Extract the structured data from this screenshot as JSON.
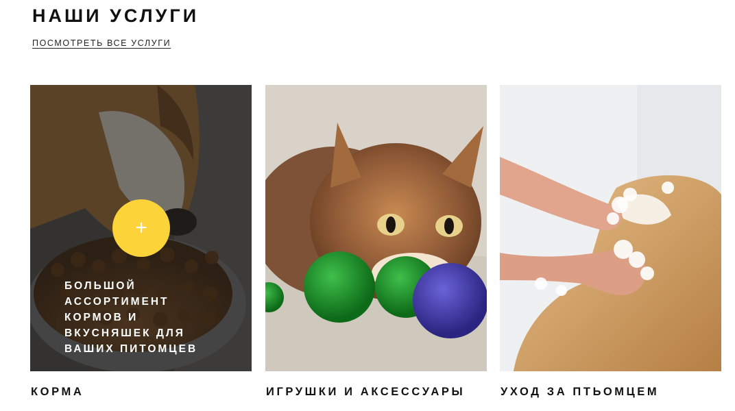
{
  "section": {
    "title": "НАШИ УСЛУГИ",
    "view_all": "ПОСМОТРЕТЬ ВСЕ УСЛУГИ"
  },
  "colors": {
    "accent": "#FDD33A",
    "overlay": "#1a1a1a"
  },
  "cards": [
    {
      "label": "КОРМА",
      "image": "dog-eating-kibble-photo",
      "hover": {
        "icon": "plus-icon",
        "symbol": "+",
        "text": "БОЛЬШОЙ АССОРТИМЕНТ КОРМОВ И ВКУСНЯШЕК ДЛЯ ВАШИХ ПИТОМЦЕВ"
      }
    },
    {
      "label": "ИГРУШКИ И АКСЕССУАРЫ",
      "image": "kitten-with-toy-balls-photo"
    },
    {
      "label": "УХОД ЗА ПТЬОМЦЕМ",
      "image": "dog-bathing-photo"
    }
  ]
}
